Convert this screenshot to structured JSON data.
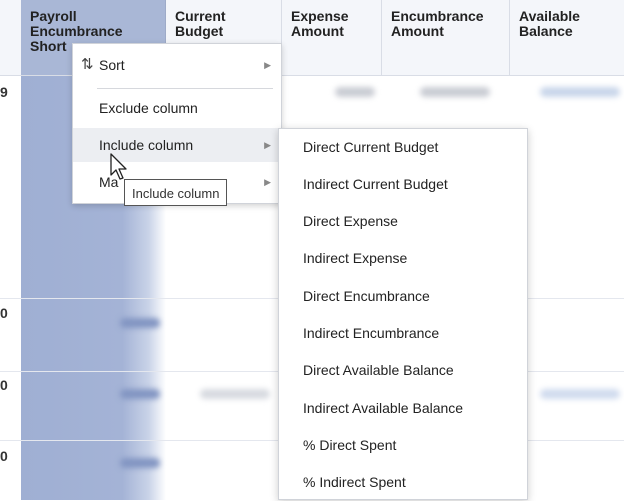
{
  "table": {
    "headers": [
      "Payroll\nEncumbrance\nShort",
      "Current\nBudget",
      "Expense\nAmount",
      "Encumbrance\nAmount",
      "Available\nBalance"
    ],
    "row_labels": [
      "9",
      "0",
      "0",
      "0"
    ]
  },
  "context_menu": {
    "items": [
      {
        "label": "Sort",
        "icon": "sort-icon",
        "has_submenu": true
      },
      {
        "label": "Exclude column",
        "has_submenu": false
      },
      {
        "label": "Include column",
        "has_submenu": true
      },
      {
        "label": "Ma",
        "has_submenu": true
      }
    ]
  },
  "submenu": {
    "items": [
      "Direct Current Budget",
      "Indirect Current Budget",
      "Direct Expense",
      "Indirect Expense",
      "Direct Encumbrance",
      "Indirect Encumbrance",
      "Direct Available Balance",
      "Indirect Available Balance",
      "% Direct Spent",
      "% Indirect Spent"
    ]
  },
  "tooltip": {
    "text": "Include column"
  },
  "colors": {
    "selected_column": "#a4b3d6",
    "header_bg": "#f4f6fa",
    "hover": "#eceef2"
  }
}
